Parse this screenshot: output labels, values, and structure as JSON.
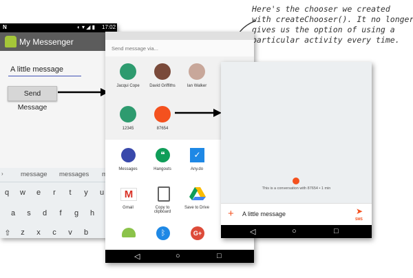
{
  "annotation": {
    "lines": [
      "Here's the chooser we created",
      "with createChooser(). It no longer",
      "gives us the option of using a",
      "particular activity every time."
    ]
  },
  "phone1": {
    "status_time": "17:02",
    "app_title": "My Messenger",
    "message_value": "A little message",
    "send_label": "Send Message",
    "suggestions": [
      "message",
      "messages",
      "m"
    ],
    "keyboard_rows": [
      [
        "q",
        "w",
        "e",
        "r",
        "t",
        "y",
        "u"
      ],
      [
        "a",
        "s",
        "d",
        "f",
        "g",
        "h"
      ],
      [
        "z",
        "x",
        "c",
        "v",
        "b"
      ]
    ]
  },
  "chooser": {
    "header": "Send message via...",
    "contacts": [
      {
        "name": "Jacqui Cope",
        "color": "#2e9b6f"
      },
      {
        "name": "David Griffiths",
        "color": "#7a4a3a"
      },
      {
        "name": "Ian Walker",
        "color": "#c8a79a"
      },
      {
        "name": "12345",
        "color": "#2e9b6f"
      },
      {
        "name": "87654",
        "color": "#f4511e"
      }
    ],
    "apps": [
      {
        "name": "Messages",
        "icon": "messages-icon",
        "color": "#3949ab"
      },
      {
        "name": "Hangouts",
        "icon": "hangouts-icon",
        "color": "#0f9d58"
      },
      {
        "name": "Any.do",
        "icon": "check-icon",
        "color": "#1e88e5"
      },
      {
        "name": "Gmail",
        "icon": "gmail-icon",
        "color": "#d93025"
      },
      {
        "name": "Copy to clipboard",
        "icon": "copy-icon",
        "color": "#616161"
      },
      {
        "name": "Save to Drive",
        "icon": "drive-icon",
        "color": "#fbbc04"
      },
      {
        "name": "",
        "icon": "android-icon",
        "color": "#8bc34a"
      },
      {
        "name": "",
        "icon": "bluetooth-icon",
        "color": "#1e88e5"
      },
      {
        "name": "",
        "icon": "google-plus-icon",
        "color": "#dd4b39"
      }
    ]
  },
  "phone3": {
    "conversation_text": "This is a conversation with 87654 • 1 min",
    "message_value": "A little message",
    "send_label": "SMS",
    "accent": "#f4511e"
  }
}
